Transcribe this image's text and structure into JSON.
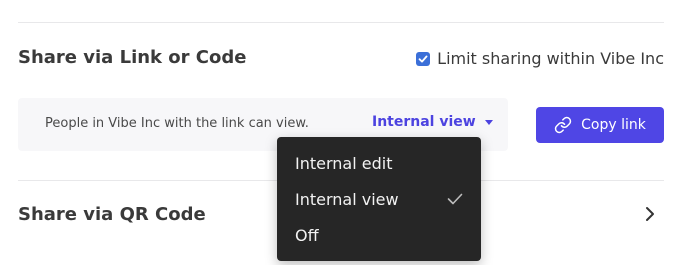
{
  "link_section": {
    "title": "Share via Link or Code",
    "limit_checkbox": {
      "label": "Limit sharing within Vibe Inc",
      "checked": true
    },
    "description": "People in Vibe Inc with the link can view.",
    "access_select": {
      "selected": "Internal view",
      "icon": "caret-down-icon"
    },
    "copy_button": {
      "label": "Copy link",
      "icon": "link-icon"
    }
  },
  "access_menu": {
    "items": [
      {
        "label": "Internal edit",
        "selected": false
      },
      {
        "label": "Internal view",
        "selected": true
      },
      {
        "label": "Off",
        "selected": false
      }
    ],
    "check_icon": "checkmark-icon"
  },
  "qr_section": {
    "title": "Share via QR Code",
    "icon": "chevron-right-icon"
  },
  "colors": {
    "accent": "#4f46e5",
    "link_text": "#4c43e0",
    "checkbox": "#3b6fd8",
    "menu_bg": "#262626",
    "panel_bg": "#f7f7f9"
  }
}
